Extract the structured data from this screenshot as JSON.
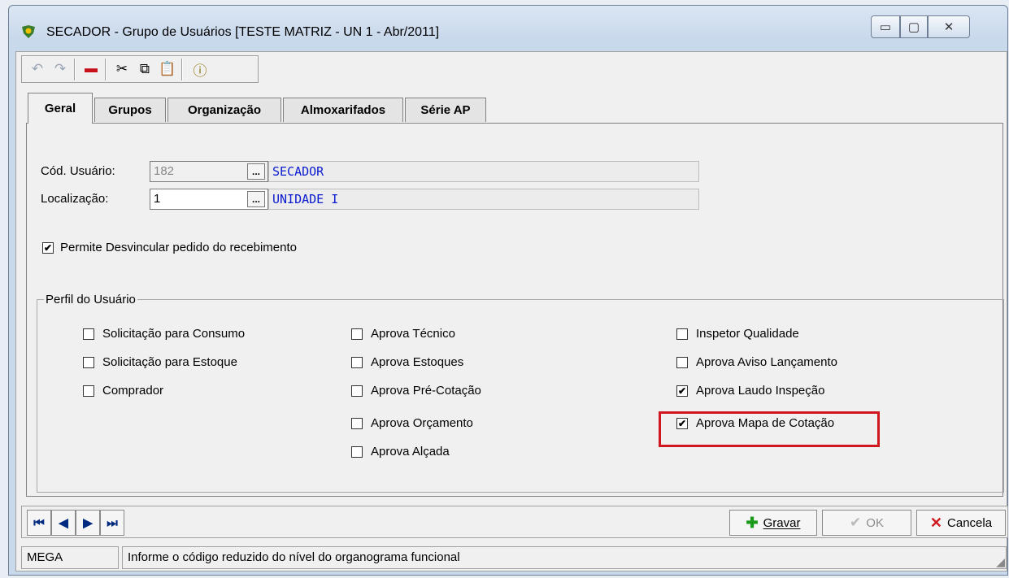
{
  "window": {
    "title": "SECADOR -  Grupo de Usuários [TESTE MATRIZ - UN 1 - Abr/2011]",
    "buttons": {
      "minimize": "▭",
      "maximize": "▢",
      "close": "✕"
    }
  },
  "toolbar": {
    "items": [
      {
        "name": "undo-icon",
        "glyph": "↶"
      },
      {
        "name": "redo-icon",
        "glyph": "↷"
      },
      {
        "name": "delete-icon",
        "glyph": "▬"
      },
      {
        "name": "cut-icon",
        "glyph": "✂"
      },
      {
        "name": "copy-icon",
        "glyph": "⧉"
      },
      {
        "name": "paste-icon",
        "glyph": "📋"
      },
      {
        "name": "info-icon",
        "glyph": "ⓘ"
      }
    ]
  },
  "tabs": [
    {
      "label": "Geral",
      "active": true
    },
    {
      "label": "Grupos",
      "active": false
    },
    {
      "label": "Organização",
      "active": false
    },
    {
      "label": "Almoxarifados",
      "active": false
    },
    {
      "label": "Série AP",
      "active": false
    }
  ],
  "form": {
    "cod_usuario": {
      "label": "Cód. Usuário:",
      "value": "182",
      "description": "SECADOR"
    },
    "localizacao": {
      "label": "Localização:",
      "value": "1",
      "description": "UNIDADE I"
    },
    "ellipsis": "...",
    "permite": {
      "label": "Permite Desvincular pedido do recebimento",
      "checked": true
    }
  },
  "perfil": {
    "title": "Perfil do Usuário",
    "col1": [
      {
        "label": "Solicitação para Consumo",
        "checked": false
      },
      {
        "label": "Solicitação para Estoque",
        "checked": false
      },
      {
        "label": "Comprador",
        "checked": false
      }
    ],
    "col2": [
      {
        "label": "Aprova Técnico",
        "checked": false
      },
      {
        "label": "Aprova Estoques",
        "checked": false
      },
      {
        "label": "Aprova Pré-Cotação",
        "checked": false
      },
      {
        "label": "Aprova Orçamento",
        "checked": false
      },
      {
        "label": "Aprova Alçada",
        "checked": false
      }
    ],
    "col3": [
      {
        "label": "Inspetor Qualidade",
        "checked": false
      },
      {
        "label": "Aprova Aviso Lançamento",
        "checked": false
      },
      {
        "label": "Aprova Laudo Inspeção",
        "checked": true
      },
      {
        "label": "Aprova Mapa de Cotação",
        "checked": true
      }
    ]
  },
  "nav": {
    "first": "⏮",
    "prev": "◀",
    "next": "▶",
    "last": "⏭",
    "gravar": "Gravar",
    "ok": "OK",
    "cancela": "Cancela"
  },
  "status": {
    "user": "MEGA",
    "message": "Informe o código reduzido do nível do organograma funcional"
  },
  "colors": {
    "link_blue": "#0a1ad0",
    "highlight_red": "#d0161f",
    "add_green": "#1a9a1a",
    "cancel_red": "#d0161f"
  }
}
